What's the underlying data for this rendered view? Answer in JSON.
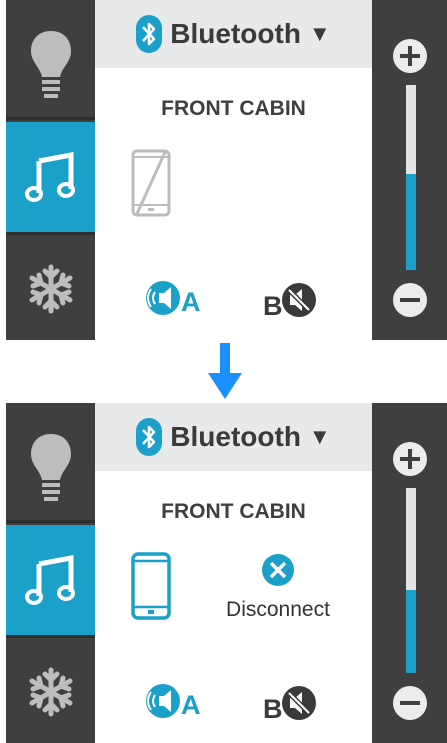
{
  "panels": [
    {
      "header": {
        "label": "Bluetooth",
        "caret": "▼"
      },
      "zone_title": "FRONT CABIN",
      "phone_state": "not-connected",
      "zones": [
        {
          "letter": "A",
          "active": true
        },
        {
          "letter": "B",
          "muted": true
        }
      ],
      "volume_level": 0.52
    },
    {
      "header": {
        "label": "Bluetooth",
        "caret": "▼"
      },
      "zone_title": "FRONT CABIN",
      "phone_state": "connected",
      "disconnect_label": "Disconnect",
      "zones": [
        {
          "letter": "A",
          "active": true
        },
        {
          "letter": "B",
          "muted": true
        }
      ],
      "volume_level": 0.45
    }
  ],
  "sidebar_tabs": [
    {
      "icon": "lightbulb-icon",
      "selected": false
    },
    {
      "icon": "music-note-icon",
      "selected": true
    },
    {
      "icon": "snowflake-icon",
      "selected": false
    }
  ],
  "colors": {
    "accent": "#1aa0c9",
    "panel_dark": "#3f3f3f",
    "header_bg": "#e7e9ea",
    "arrow": "#1a8fff"
  }
}
